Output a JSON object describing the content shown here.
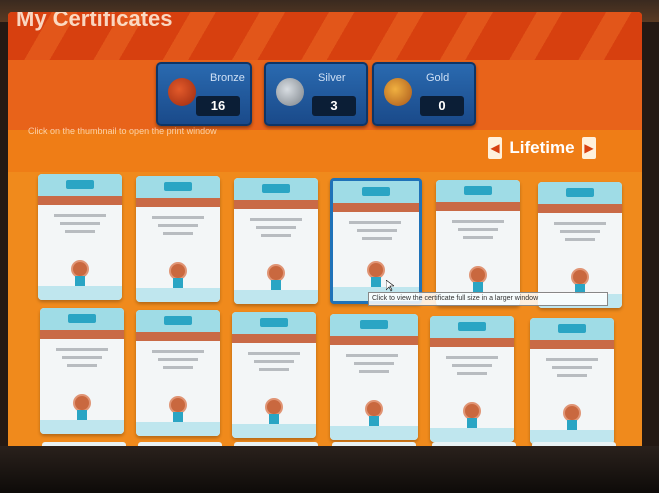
{
  "header": {
    "title": "My Certificates"
  },
  "medals": [
    {
      "label": "Bronze",
      "count": "16",
      "color": "#c0401a"
    },
    {
      "label": "Silver",
      "count": "3",
      "color": "#9aa0a6"
    },
    {
      "label": "Gold",
      "count": "0",
      "color": "#d3902a"
    }
  ],
  "hint": "Click on the thumbnail to open the print window",
  "period": {
    "label": "Lifetime",
    "prev_icon": "arrow-left-icon",
    "next_icon": "arrow-right-icon"
  },
  "tooltip": "Click to view the certificate full size in a larger window",
  "certificates": [
    {
      "row": 0,
      "selected": false
    },
    {
      "row": 0,
      "selected": false
    },
    {
      "row": 0,
      "selected": false
    },
    {
      "row": 0,
      "selected": true
    },
    {
      "row": 0,
      "selected": false
    },
    {
      "row": 0,
      "selected": false
    },
    {
      "row": 1,
      "selected": false
    },
    {
      "row": 1,
      "selected": false
    },
    {
      "row": 1,
      "selected": false
    },
    {
      "row": 1,
      "selected": false
    },
    {
      "row": 1,
      "selected": false
    },
    {
      "row": 1,
      "selected": false
    }
  ],
  "colors": {
    "accent_orange": "#ef7d16",
    "panel_blue": "#1f5ea8",
    "selection_blue": "#1f72b8",
    "cert_header": "#9fdce6"
  }
}
